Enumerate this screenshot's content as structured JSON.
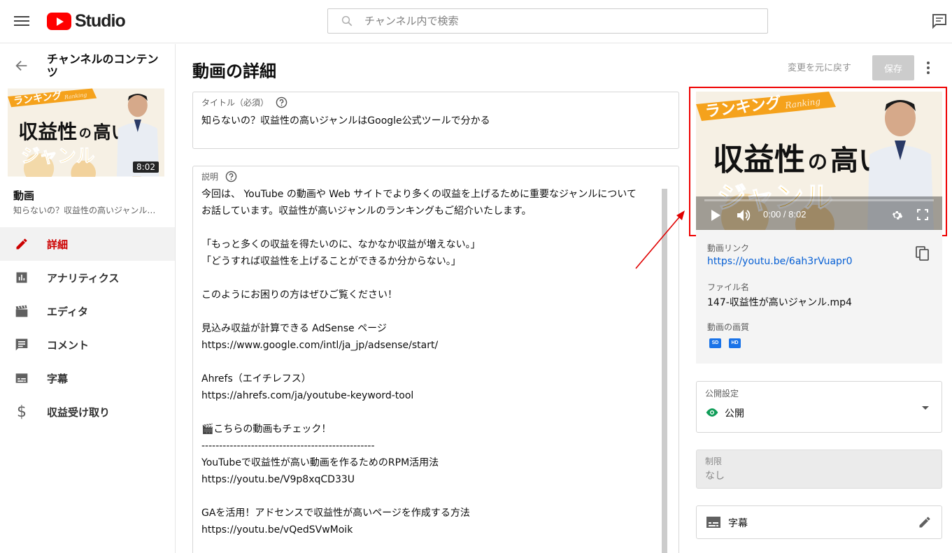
{
  "app": {
    "logo_text": "Studio"
  },
  "search": {
    "placeholder": "チャンネル内で検索"
  },
  "sidebar": {
    "section_title": "チャンネルのコンテンツ",
    "thumb_duration": "8:02",
    "video_label": "動画",
    "video_title": "知らないの？収益性の高いジャンルはGoogle公式ツールで分かる",
    "items": [
      {
        "label": "詳細",
        "icon": "pencil-icon",
        "active": true
      },
      {
        "label": "アナリティクス",
        "icon": "analytics-icon",
        "active": false
      },
      {
        "label": "エディタ",
        "icon": "clapperboard-icon",
        "active": false
      },
      {
        "label": "コメント",
        "icon": "comment-icon",
        "active": false
      },
      {
        "label": "字幕",
        "icon": "subtitles-icon",
        "active": false
      },
      {
        "label": "収益受け取り",
        "icon": "dollar-icon",
        "active": false
      }
    ]
  },
  "main": {
    "page_title": "動画の詳細",
    "revert_label": "変更を元に戻す",
    "save_label": "保存",
    "title_field": {
      "label": "タイトル（必須）",
      "value": "知らないの？収益性の高いジャンルはGoogle公式ツールで分かる"
    },
    "description_field": {
      "label": "説明",
      "lines": [
        "今回は、 YouTube の動画や Web サイトでより多くの収益を上げるために重要なジャンルについて",
        "お話しています。収益性が高いジャンルのランキングもご紹介いたします。",
        "",
        "「もっと多くの収益を得たいのに、なかなか収益が増えない。」",
        "「どうすれば収益性を上げることができるか分からない。」",
        "",
        "このようにお困りの方はぜひご覧ください！",
        "",
        "見込み収益が計算できる AdSense ページ",
        "https://www.google.com/intl/ja_jp/adsense/start/",
        "",
        "Ahrefs（エイチレフス）",
        "https://ahrefs.com/ja/youtube-keyword-tool",
        "",
        "🎬こちらの動画もチェック！",
        "-------------------------------------------------",
        "YouTubeで収益性が高い動画を作るためのRPM活用法",
        "https://youtu.be/V9p8xqCD33U",
        "",
        "GAを活用！アドセンスで収益性が高いページを作成する方法",
        "https://youtu.be/vQedSVwMoik"
      ]
    }
  },
  "thumbnail": {
    "ranking_text": "ランキング",
    "ranking_sub": "Ranking",
    "headline_1": "収益性",
    "headline_no": "の",
    "headline_2": "高い",
    "headline_3": "ジャンル"
  },
  "player": {
    "time": "0:00 / 8:02"
  },
  "video_info": {
    "link_label": "動画リンク",
    "link_value": "https://youtu.be/6ah3rVuapr0",
    "filename_label": "ファイル名",
    "filename_value": "147-収益性が高いジャンル.mp4",
    "quality_label": "動画の画質",
    "quality_badges": [
      "SD",
      "HD"
    ]
  },
  "visibility": {
    "label": "公開設定",
    "value": "公開"
  },
  "restrictions": {
    "label": "制限",
    "value": "なし"
  },
  "subtitles": {
    "label": "字幕"
  },
  "colors": {
    "accent_red": "#cc0000",
    "link_blue": "#065fd4",
    "annotation_red": "#e00000"
  }
}
